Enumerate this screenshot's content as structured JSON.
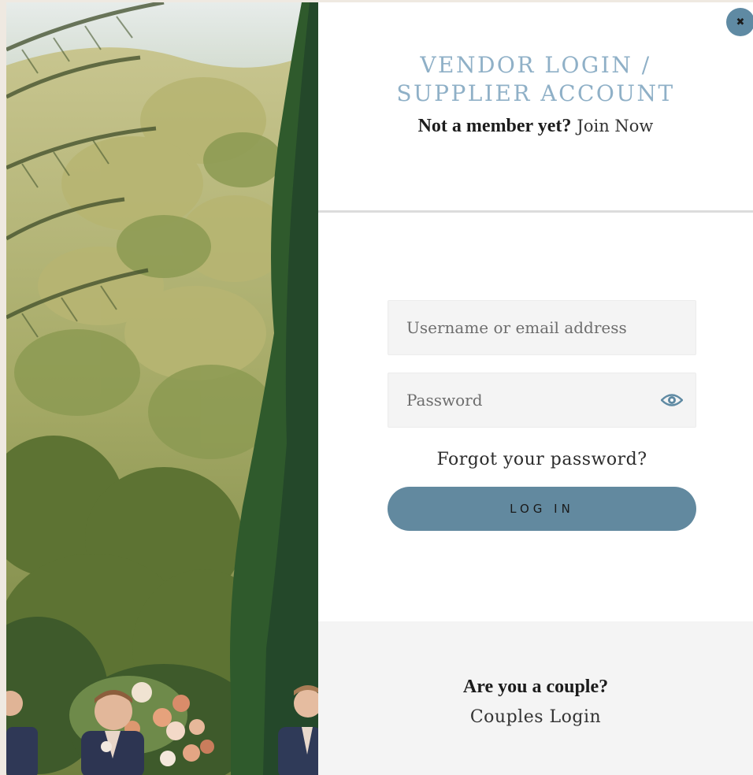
{
  "header": {
    "title_line1": "VENDOR LOGIN /",
    "title_line2": "SUPPLIER ACCOUNT",
    "member_question": "Not a member yet?",
    "join_link": "Join Now"
  },
  "form": {
    "username_placeholder": "Username or email address",
    "password_placeholder": "Password",
    "forgot_link": "Forgot your password?",
    "login_label": "LOG IN"
  },
  "footer": {
    "couple_question": "Are you a couple?",
    "couples_link": "Couples Login"
  },
  "icons": {
    "close": "close-icon",
    "eye": "eye-icon"
  },
  "colors": {
    "accent": "#62899f",
    "title": "#8fb0c7",
    "footer_bg": "#f4f4f4"
  }
}
